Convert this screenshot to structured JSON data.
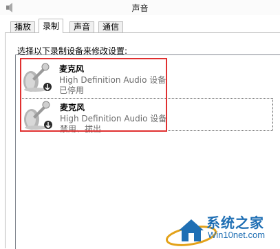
{
  "window": {
    "title": "声音"
  },
  "tabs": [
    {
      "label": "播放"
    },
    {
      "label": "录制"
    },
    {
      "label": "声音"
    },
    {
      "label": "通信"
    }
  ],
  "instruction": "选择以下录制设备来修改设置:",
  "devices": [
    {
      "name": "麦克风",
      "description": "High Definition Audio 设备",
      "status": "已停用"
    },
    {
      "name": "麦克风",
      "description": "High Definition Audio 设备",
      "status": "禁用、拔出"
    }
  ],
  "watermark": {
    "brand": "系统之家",
    "url": "Win10net.com"
  },
  "colors": {
    "highlight": "#e03030",
    "watermark": "#1f6fb4"
  }
}
